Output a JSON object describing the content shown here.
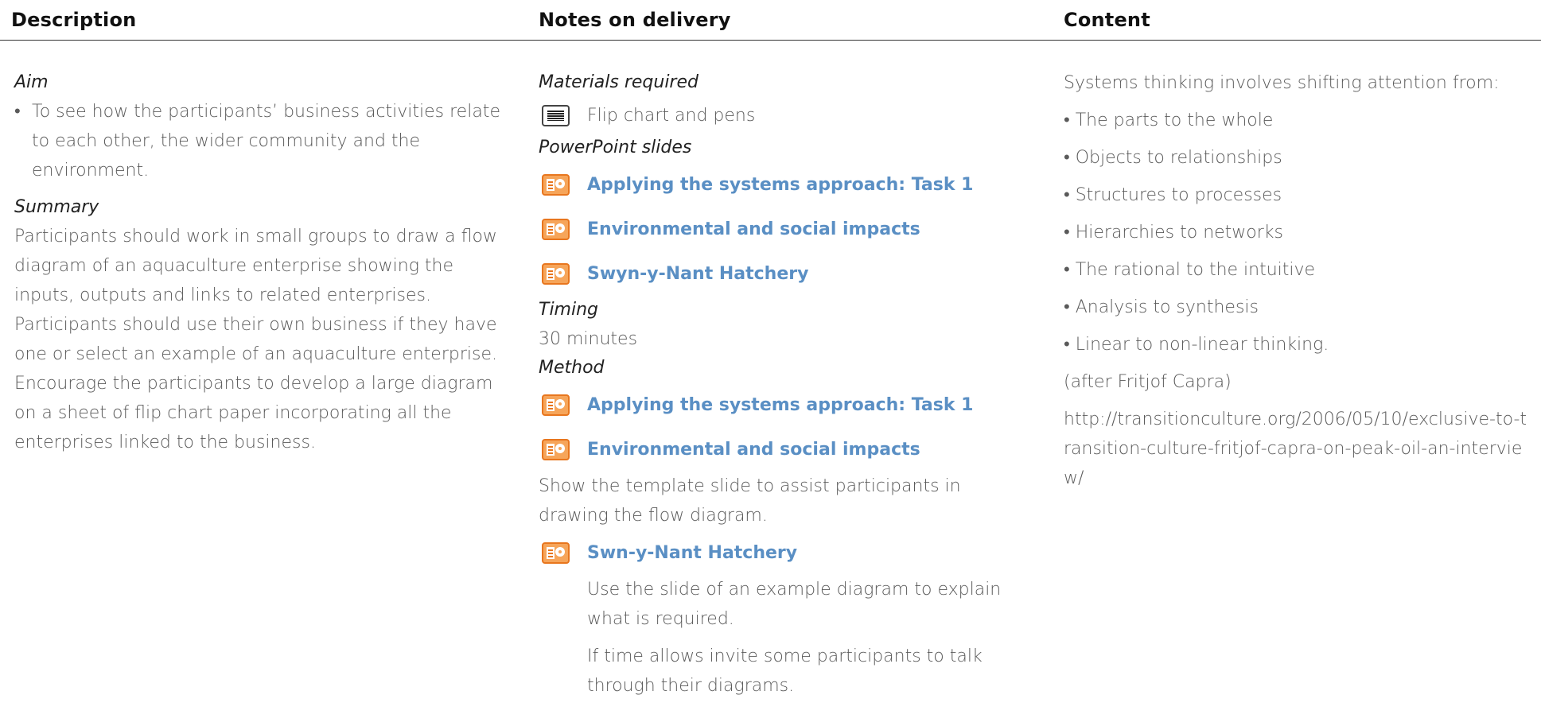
{
  "headers": {
    "description": "Description",
    "notes": "Notes on delivery",
    "content": "Content"
  },
  "description": {
    "aim_heading": "Aim",
    "aim_bullet": "To see how the participants’ business activities relate to each other, the wider community and the environment.",
    "summary_heading": "Summary",
    "summary_text": "Participants should work in small groups to draw a flow diagram of an aquaculture enterprise showing the inputs, outputs and links to related enterprises. Participants should use their own business if they have one or select an example of an aquaculture enterprise. Encourage the participants to develop a large diagram on a sheet of flip chart paper incorporating all the enterprises linked to the business."
  },
  "notes": {
    "materials_heading": "Materials required",
    "materials_item": "Flip chart and pens",
    "slides_heading": "PowerPoint slides",
    "slides": [
      "Applying the systems approach: Task 1",
      "Environmental and social impacts",
      "Swyn-y-Nant Hatchery"
    ],
    "timing_heading": "Timing",
    "timing_value": "30 minutes",
    "method_heading": "Method",
    "method_slides": [
      "Applying the systems approach: Task 1",
      "Environmental and social impacts"
    ],
    "method_text": "Show the template slide to assist participants in drawing the flow diagram.",
    "method_slide_3": "Swn-y-Nant Hatchery",
    "method_note_1": "Use the slide of an example diagram to explain what is required.",
    "method_note_2": "If time allows invite some participants to talk through their diagrams."
  },
  "content": {
    "intro": "Systems thinking involves shifting attention from:",
    "bullets": [
      "The parts to the whole",
      "Objects to relationships",
      "Structures to processes",
      "Hierarchies to networks",
      "The rational to the intuitive",
      "Analysis to synthesis",
      "Linear to non-linear thinking."
    ],
    "attribution": "(after Fritjof Capra)",
    "url": "http://transitionculture.org/2006/05/10/exclusive-to-transition-culture-fritjof-capra-on-peak-oil-an-interview/"
  },
  "icons": {
    "materials": "flip-chart-icon",
    "slide": "powerpoint-slide-icon"
  },
  "colors": {
    "slide_link": "#5a8fc4",
    "slide_icon": "#f6a55a"
  }
}
